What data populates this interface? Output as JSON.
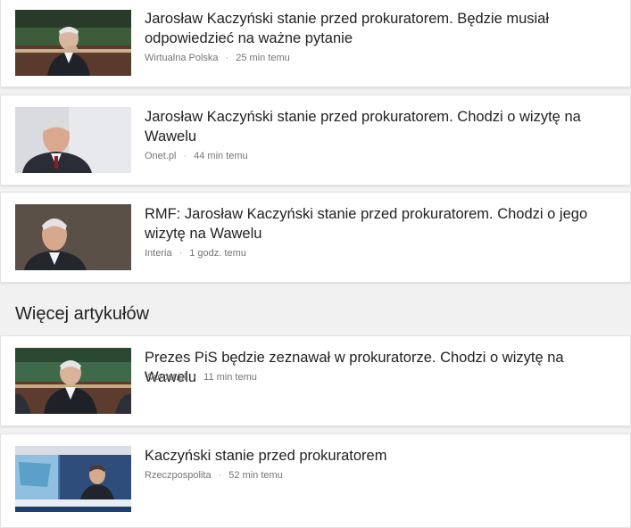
{
  "articles": [
    {
      "headline": "Jarosław Kaczyński stanie przed prokuratorem. Będzie musiał odpowiedzieć na ważne pytanie",
      "source": "Wirtualna Polska",
      "time": "25 min temu"
    },
    {
      "headline": "Jarosław Kaczyński stanie przed prokuratorem. Chodzi o wizytę na Wawelu",
      "source": "Onet.pl",
      "time": "44 min temu"
    },
    {
      "headline": "RMF: Jarosław Kaczyński stanie przed prokuratorem. Chodzi o jego wizytę na Wawelu",
      "source": "Interia",
      "time": "1 godz. temu"
    }
  ],
  "more_section": {
    "title": "Więcej artykułów",
    "articles": [
      {
        "headline": "Prezes PiS będzie zeznawał w prokuratorze. Chodzi o wizytę na Wawelu",
        "source": "Wprost.pl",
        "time": "11 min temu"
      },
      {
        "headline": "Kaczyński stanie przed prokuratorem",
        "source": "Rzeczpospolita",
        "time": "52 min temu"
      }
    ]
  },
  "separator": "·",
  "colors": {
    "background": "#f1f1f1",
    "card": "#ffffff",
    "headline": "#222222",
    "meta": "#757575"
  }
}
